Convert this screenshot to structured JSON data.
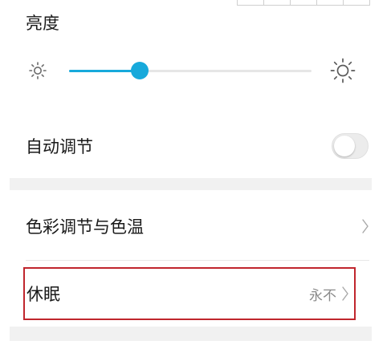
{
  "brightness": {
    "title": "亮度",
    "level_percent": 29,
    "dim_icon": "sun-small-icon",
    "bright_icon": "sun-large-icon"
  },
  "auto_adjust": {
    "label": "自动调节",
    "enabled": false
  },
  "color_temperature": {
    "label": "色彩调节与色温",
    "icon": "chevron-right-icon"
  },
  "sleep": {
    "label": "休眠",
    "value": "永不",
    "icon": "chevron-right-icon"
  },
  "colors": {
    "accent": "#17a9db",
    "highlight_border": "#c0262d",
    "section_gap": "#f1f1f1",
    "secondary_text": "#8a8a8a"
  }
}
